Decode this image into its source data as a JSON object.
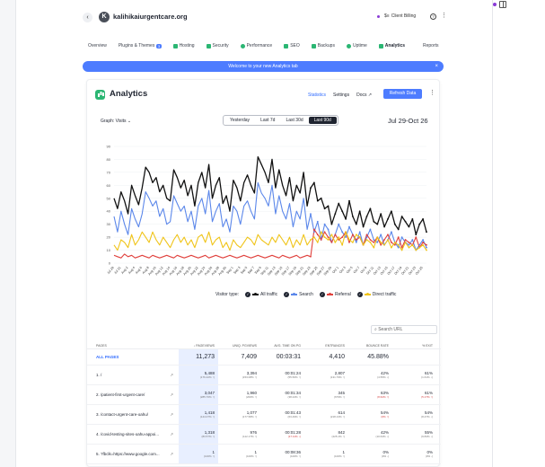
{
  "site": {
    "name": "kalihikaiurgentcare.org",
    "avatar_letter": "K"
  },
  "header": {
    "client_billing": "Client Billing",
    "back": "‹",
    "help": "?",
    "more": "⋮"
  },
  "tabs": [
    {
      "label": "Overview",
      "icon": "none"
    },
    {
      "label": "Plugins & Themes",
      "icon": "none",
      "badge": "3"
    },
    {
      "label": "Hosting",
      "icon": "hosting-icon"
    },
    {
      "label": "Security",
      "icon": "shield-icon"
    },
    {
      "label": "Performance",
      "icon": "gauge-icon"
    },
    {
      "label": "SEO",
      "icon": "seo-icon"
    },
    {
      "label": "Backups",
      "icon": "backup-icon"
    },
    {
      "label": "Uptime",
      "icon": "uptime-icon"
    },
    {
      "label": "Analytics",
      "icon": "analytics-icon",
      "active": true
    }
  ],
  "reports_label": "Reports",
  "banner": {
    "text": "Welcome to your new Analytics tab",
    "close": "×"
  },
  "card": {
    "title": "Analytics",
    "nav": [
      "Statistics",
      "Settings",
      "Docs ↗"
    ],
    "refresh": "Refresh Data",
    "graph_label": "Graph: Visits ⌄",
    "ranges": [
      "Yesterday",
      "Last 7d",
      "Last 30d",
      "Last 90d"
    ],
    "active_range": "Last 90d",
    "date_range": "Jul 29-Oct 26"
  },
  "colors": {
    "accent": "#4d7cff",
    "all": "#111111",
    "search": "#5b87ea",
    "referral": "#e0413d",
    "direct": "#f0c419"
  },
  "chart_data": {
    "type": "line",
    "title": "",
    "ylim": [
      0,
      90
    ],
    "yticks": [
      0,
      10,
      20,
      30,
      40,
      50,
      60,
      70,
      80,
      90
    ],
    "x": [
      "Jul 29",
      "Jul 30",
      "Jul 31",
      "Aug 1",
      "Aug 2",
      "Aug 3",
      "Aug 4",
      "Aug 5",
      "Aug 6",
      "Aug 7",
      "Aug 8",
      "Aug 9",
      "Aug 10",
      "Aug 11",
      "Aug 12",
      "Aug 13",
      "Aug 14",
      "Aug 15",
      "Aug 16",
      "Aug 17",
      "Aug 18",
      "Aug 19",
      "Aug 20",
      "Aug 21",
      "Aug 22",
      "Aug 23",
      "Aug 24",
      "Aug 25",
      "Aug 26",
      "Aug 27",
      "Aug 28",
      "Aug 29",
      "Aug 30",
      "Aug 31",
      "Sep 1",
      "Sep 2",
      "Sep 3",
      "Sep 4",
      "Sep 5",
      "Sep 6",
      "Sep 7",
      "Sep 8",
      "Sep 9",
      "Sep 10",
      "Sep 11",
      "Sep 12",
      "Sep 13",
      "Sep 14",
      "Sep 15",
      "Sep 16",
      "Sep 17",
      "Sep 18",
      "Sep 19",
      "Sep 20",
      "Sep 21",
      "Sep 22",
      "Sep 23",
      "Sep 24",
      "Sep 25",
      "Sep 26",
      "Sep 27",
      "Sep 28",
      "Sep 29",
      "Sep 30",
      "Oct 1",
      "Oct 2",
      "Oct 3",
      "Oct 4",
      "Oct 5",
      "Oct 6",
      "Oct 7",
      "Oct 8",
      "Oct 9",
      "Oct 10",
      "Oct 11",
      "Oct 12",
      "Oct 13",
      "Oct 14",
      "Oct 15",
      "Oct 16",
      "Oct 17",
      "Oct 18",
      "Oct 19",
      "Oct 20",
      "Oct 21",
      "Oct 22",
      "Oct 23",
      "Oct 24",
      "Oct 25",
      "Oct 26"
    ],
    "xtick_labels": [
      "Jul 29",
      "Jul 31",
      "Aug 2",
      "Aug 4",
      "Aug 6",
      "Aug 8",
      "Aug 10",
      "Aug 12",
      "Aug 14",
      "Aug 16",
      "Aug 18",
      "Aug 20",
      "Aug 22",
      "Aug 24",
      "Aug 26",
      "Aug 28",
      "Aug 30",
      "Sep 1",
      "Sep 3",
      "Sep 5",
      "Sep 7",
      "Sep 9",
      "Sep 11",
      "Sep 13",
      "Sep 15",
      "Sep 17",
      "Sep 19",
      "Sep 21",
      "Sep 23",
      "Sep 25",
      "Sep 27",
      "Sep 29",
      "Oct 1",
      "Oct 3",
      "Oct 5",
      "Oct 7",
      "Oct 9",
      "Oct 11",
      "Oct 13",
      "Oct 15",
      "Oct 17",
      "Oct 19",
      "Oct 21",
      "Oct 23",
      "Oct 25"
    ],
    "series": [
      {
        "name": "All traffic",
        "color": "#111111",
        "values": [
          50,
          42,
          55,
          48,
          38,
          60,
          52,
          45,
          58,
          74,
          70,
          62,
          66,
          55,
          60,
          50,
          48,
          72,
          66,
          58,
          64,
          52,
          60,
          44,
          62,
          70,
          58,
          76,
          50,
          60,
          66,
          46,
          52,
          40,
          64,
          58,
          48,
          62,
          68,
          60,
          54,
          82,
          76,
          70,
          62,
          80,
          58,
          72,
          60,
          52,
          66,
          48,
          60,
          54,
          70,
          44,
          58,
          62,
          48,
          50,
          42,
          44,
          30,
          38,
          46,
          40,
          34,
          48,
          36,
          30,
          40,
          28,
          36,
          42,
          32,
          30,
          38,
          28,
          34,
          40,
          30,
          26,
          36,
          32,
          28,
          34,
          22,
          30,
          34,
          24
        ]
      },
      {
        "name": "Search",
        "color": "#5b87ea",
        "values": [
          36,
          24,
          40,
          30,
          22,
          42,
          34,
          28,
          38,
          55,
          50,
          44,
          48,
          36,
          42,
          30,
          32,
          52,
          46,
          40,
          44,
          32,
          40,
          26,
          44,
          50,
          38,
          56,
          32,
          40,
          46,
          28,
          34,
          24,
          44,
          40,
          30,
          44,
          48,
          40,
          34,
          62,
          54,
          50,
          44,
          60,
          38,
          52,
          40,
          34,
          46,
          28,
          40,
          34,
          50,
          26,
          38,
          24,
          32,
          18,
          30,
          26,
          16,
          22,
          30,
          24,
          20,
          28,
          22,
          16,
          24,
          14,
          20,
          26,
          18,
          16,
          22,
          14,
          18,
          24,
          16,
          12,
          20,
          16,
          14,
          18,
          10,
          14,
          18,
          12
        ]
      },
      {
        "name": "Referral",
        "color": "#e0413d",
        "values": [
          6,
          5,
          4,
          7,
          5,
          6,
          4,
          5,
          6,
          5,
          4,
          6,
          5,
          4,
          5,
          6,
          5,
          4,
          6,
          5,
          4,
          5,
          6,
          5,
          4,
          5,
          6,
          4,
          5,
          6,
          5,
          4,
          5,
          6,
          5,
          4,
          5,
          6,
          5,
          4,
          5,
          6,
          5,
          4,
          5,
          6,
          5,
          4,
          6,
          5,
          4,
          5,
          6,
          4,
          5,
          6,
          5,
          26,
          22,
          18,
          24,
          20,
          16,
          22,
          18,
          20,
          24,
          16,
          22,
          18,
          20,
          14,
          22,
          18,
          16,
          20,
          14,
          18,
          22,
          16,
          14,
          20,
          12,
          18,
          16,
          14,
          20,
          12,
          16,
          14
        ]
      },
      {
        "name": "Direct traffic",
        "color": "#f0c419",
        "values": [
          14,
          10,
          18,
          16,
          12,
          22,
          14,
          18,
          24,
          20,
          16,
          24,
          18,
          14,
          20,
          16,
          12,
          18,
          22,
          16,
          20,
          14,
          18,
          12,
          20,
          22,
          16,
          24,
          14,
          18,
          20,
          12,
          16,
          10,
          18,
          14,
          12,
          16,
          20,
          18,
          14,
          22,
          18,
          16,
          14,
          20,
          16,
          22,
          18,
          14,
          20,
          12,
          18,
          14,
          22,
          14,
          18,
          20,
          16,
          24,
          20,
          18,
          22,
          16,
          20,
          14,
          24,
          18,
          16,
          22,
          20,
          14,
          18,
          16,
          12,
          20,
          16,
          14,
          18,
          12,
          16,
          14,
          10,
          16,
          12,
          14,
          10,
          12,
          14,
          10
        ]
      }
    ],
    "legend_position": "bottom",
    "legend_label": "Visitor type:"
  },
  "search": {
    "placeholder": "Search URL"
  },
  "table": {
    "headers": [
      "PAGES",
      "↓ PAGEVIEWS",
      "UNIQ. PGVIEWS",
      "AVG. TIME ON PG",
      "ENTRANCES",
      "BOUNCE RATE",
      "% EXIT"
    ],
    "all": {
      "label": "ALL PAGES",
      "pageviews": "11,273",
      "uniq": "7,409",
      "avg": "00:03:31",
      "entrances": "4,410",
      "bounce": "45.88%",
      "exit": ""
    },
    "rows": [
      {
        "page": "1. /",
        "pv": "5,488",
        "pv_d": "(176.42% ↑)",
        "uq": "3,394",
        "uq_d": "(153.08% ↑)",
        "avg": "00:01:24",
        "avg_d": "(55.56% ↑)",
        "ent": "2,807",
        "ent_d": "(131.79% ↑)",
        "br": "42%",
        "br_d": "(4.55% ↓)",
        "ex": "61%",
        "ex_d": "(1.61% ↓)"
      },
      {
        "page": "2. /patient-first-urgent-care/",
        "pv": "3,047",
        "pv_d": "(285.70% ↑)",
        "uq": "1,960",
        "uq_d": "(200% ↑)",
        "avg": "00:01:34",
        "avg_d": "(38.24% ↑)",
        "ent": "345",
        "ent_d": "(679% ↑)",
        "br": "63%",
        "br_d": "(8.62% ↑)",
        "ex": "61%",
        "ex_d": "(5.17% ↑)"
      },
      {
        "page": "3. /contact-urgent-care-oahu/",
        "pv": "1,418",
        "pv_d": "(144.07% ↑)",
        "uq": "1,077",
        "uq_d": "(177.58% ↑)",
        "avg": "00:01:43",
        "avg_d": "(63.49% ↑)",
        "ent": "614",
        "ent_d": "(218.13% ↑)",
        "br": "54%",
        "br_d": "(0% ↑)",
        "ex": "54%",
        "ex_d": "(8.47% ↓)"
      },
      {
        "page": "4. /covid-testing-sites-oahu-appoi...",
        "pv": "1,318",
        "pv_d": "(83.57% ↑)",
        "uq": "976",
        "uq_d": "(112.17% ↑)",
        "avg": "00:01:28",
        "avg_d": "(17.11% ↓)",
        "ent": "842",
        "ent_d": "(225.1% ↑)",
        "br": "42%",
        "br_d": "(10.64% ↓)",
        "ex": "55%",
        "ex_d": "(9.84% ↓)"
      },
      {
        "page": "5. ?fbclk=https://www.google.com...",
        "pv": "1",
        "pv_d": "(100% ↑)",
        "uq": "1",
        "uq_d": "(100% ↑)",
        "avg": "00:08:36",
        "avg_d": "(100% ↑)",
        "ent": "1",
        "ent_d": "(100% ↑)",
        "br": "0%",
        "br_d": "(0% -)",
        "ex": "0%",
        "ex_d": "(0% -)"
      }
    ]
  }
}
